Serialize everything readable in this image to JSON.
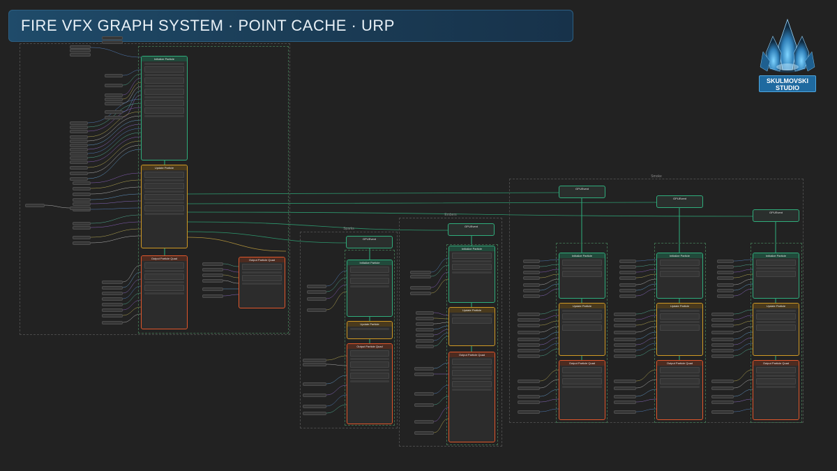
{
  "title": "FIRE VFX GRAPH SYSTEM · POINT CACHE · URP",
  "logo": {
    "line1": "SKULMOVSKI",
    "line2": "STUDIO",
    "icon": "crystal-icon",
    "accent": "#4fa6df"
  },
  "colors": {
    "spawn_context": "#2fae7c",
    "update_context": "#d19a24",
    "output_context": "#e2572b",
    "background": "#222222"
  },
  "groups": {
    "main_label": "Fire",
    "sparks_label": "Sparks",
    "embers_label": "Embers",
    "smoke_label": "Smoke"
  },
  "canvas": {
    "initialize_label": "Initialize Particle",
    "update_label": "Update Particle",
    "output_label": "Output Particle Quad",
    "event_label": "GPUEvent"
  }
}
